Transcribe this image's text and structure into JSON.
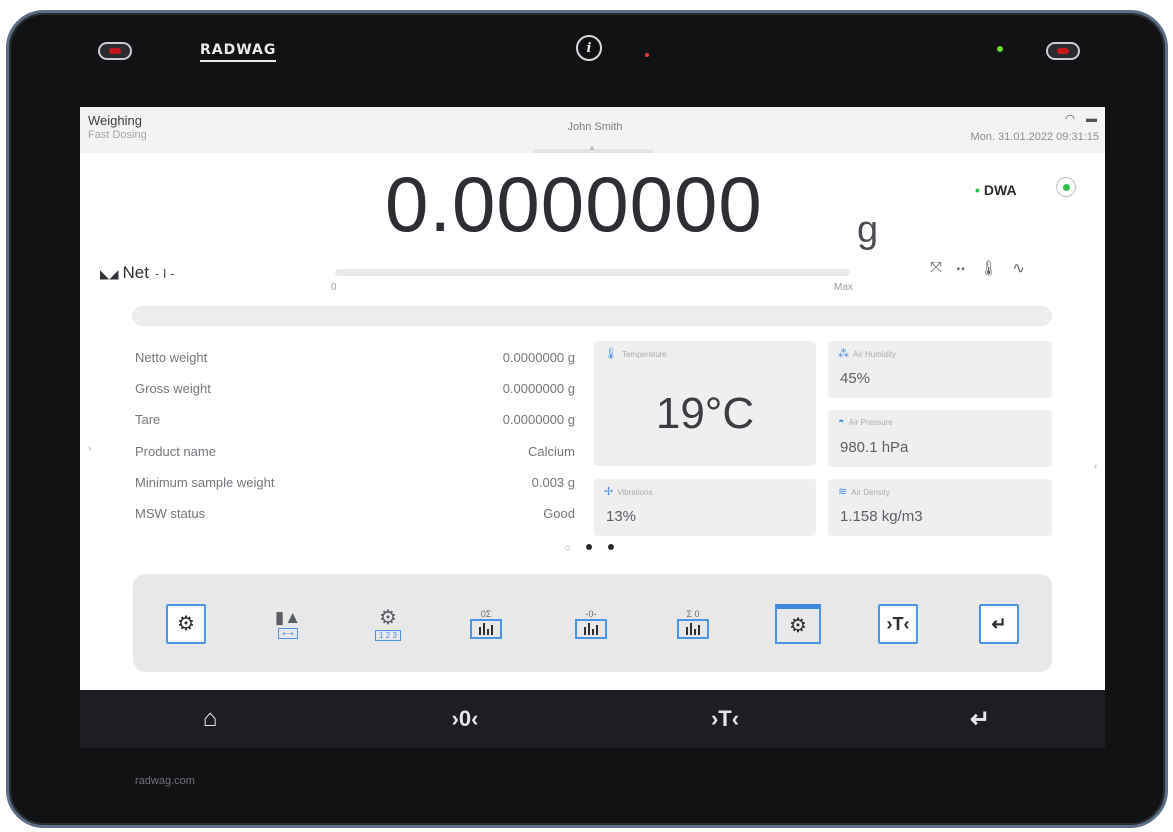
{
  "device": {
    "brand_logo": "RADWAG",
    "brand_footer": "radwag.com"
  },
  "status_bar": {
    "mode": "Weighing",
    "submode": "Fast Dosing",
    "user": "John Smith",
    "datetime": "Mon. 31.01.2022  09:31:15",
    "icons": [
      "wifi-icon",
      "battery-icon"
    ]
  },
  "weighing": {
    "reading": "0.0000000",
    "unit": "g",
    "dwa_label": "DWA",
    "net_label": "Net",
    "stability_marks": "- I -",
    "bar_min": "0",
    "bar_max": "Max",
    "bar_fill_fraction": 0
  },
  "parameters": [
    {
      "label": "Netto weight",
      "value": "0.0000000 g"
    },
    {
      "label": "Gross weight",
      "value": "0.0000000 g"
    },
    {
      "label": "Tare",
      "value": "0.0000000 g"
    },
    {
      "label": "Product name",
      "value": "Calcium"
    },
    {
      "label": "Minimum sample weight",
      "value": "0.003 g"
    },
    {
      "label": "MSW status",
      "value": "Good"
    }
  ],
  "sensors": {
    "temperature": {
      "title": "Temperature",
      "value": "19°C"
    },
    "humidity": {
      "title": "Air Humidity",
      "value": "45%"
    },
    "pressure": {
      "title": "Air Pressure",
      "value": "980.1 hPa"
    },
    "vibrations": {
      "title": "Vibrations",
      "value": "13%"
    },
    "density": {
      "title": "Air Density",
      "value": "1.158 kg/m3"
    }
  },
  "toolbar": {
    "buttons": [
      {
        "name": "settings-button",
        "icon": "gear-icon"
      },
      {
        "name": "weighing-units-button",
        "icon": "weights-icon"
      },
      {
        "name": "parameters-button",
        "icon": "gear-numbers-icon",
        "caption": "1 2 3"
      },
      {
        "name": "statistics-sum-button",
        "icon": "chart-icon",
        "caption": "0Σ"
      },
      {
        "name": "statistics-zero-button",
        "icon": "chart-icon",
        "caption": "-0-"
      },
      {
        "name": "statistics-button",
        "icon": "chart-icon",
        "caption": "Σ 0"
      },
      {
        "name": "window-settings-button",
        "icon": "gear-window-icon"
      },
      {
        "name": "tare-button",
        "icon": "tare-icon",
        "label": "›T‹"
      },
      {
        "name": "enter-button",
        "icon": "enter-icon",
        "label": "↵"
      }
    ]
  },
  "hardware_keys": {
    "home": "home-icon",
    "zero": "›0‹",
    "tare": "›T‹",
    "enter": "↵"
  }
}
